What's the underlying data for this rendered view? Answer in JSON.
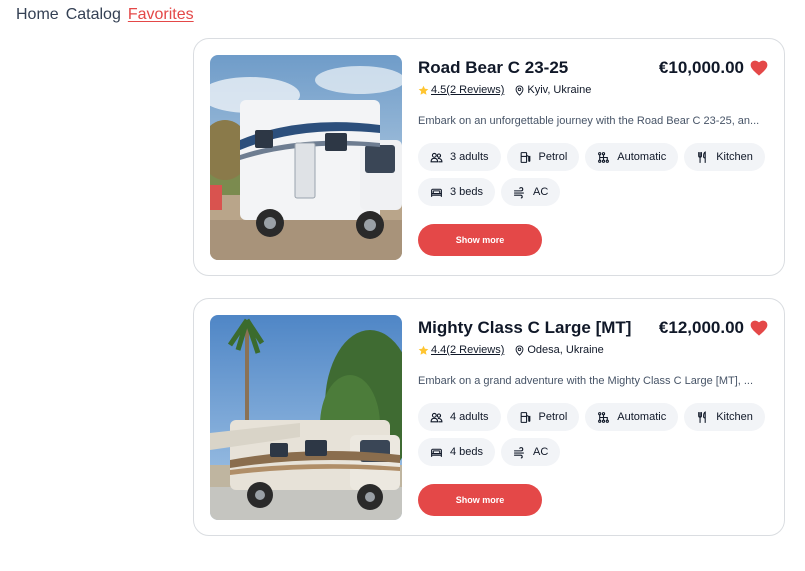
{
  "nav": {
    "home": "Home",
    "catalog": "Catalog",
    "favorites": "Favorites"
  },
  "colors": {
    "accent": "#e44848",
    "rating_star": "#ffc531",
    "chip_bg": "#f2f4f7"
  },
  "cards": [
    {
      "title": "Road Bear C 23-25",
      "price": "€10,000.00",
      "favorited": true,
      "rating": "4.5(2 Reviews)",
      "location": "Kyiv, Ukraine",
      "description": "Embark on an unforgettable journey with the Road Bear C 23-25, an...",
      "features": [
        {
          "icon": "adults-icon",
          "label": "3 adults"
        },
        {
          "icon": "fuel-icon",
          "label": "Petrol"
        },
        {
          "icon": "transmission-icon",
          "label": "Automatic"
        },
        {
          "icon": "kitchen-icon",
          "label": "Kitchen"
        },
        {
          "icon": "bed-icon",
          "label": "3 beds"
        },
        {
          "icon": "ac-icon",
          "label": "AC"
        }
      ],
      "button": "Show more"
    },
    {
      "title": "Mighty Class C Large [MT]",
      "price": "€12,000.00",
      "favorited": true,
      "rating": "4.4(2 Reviews)",
      "location": "Odesa, Ukraine",
      "description": "Embark on a grand adventure with the Mighty Class C Large [MT], ...",
      "features": [
        {
          "icon": "adults-icon",
          "label": "4 adults"
        },
        {
          "icon": "fuel-icon",
          "label": "Petrol"
        },
        {
          "icon": "transmission-icon",
          "label": "Automatic"
        },
        {
          "icon": "kitchen-icon",
          "label": "Kitchen"
        },
        {
          "icon": "bed-icon",
          "label": "4 beds"
        },
        {
          "icon": "ac-icon",
          "label": "AC"
        }
      ],
      "button": "Show more"
    }
  ]
}
